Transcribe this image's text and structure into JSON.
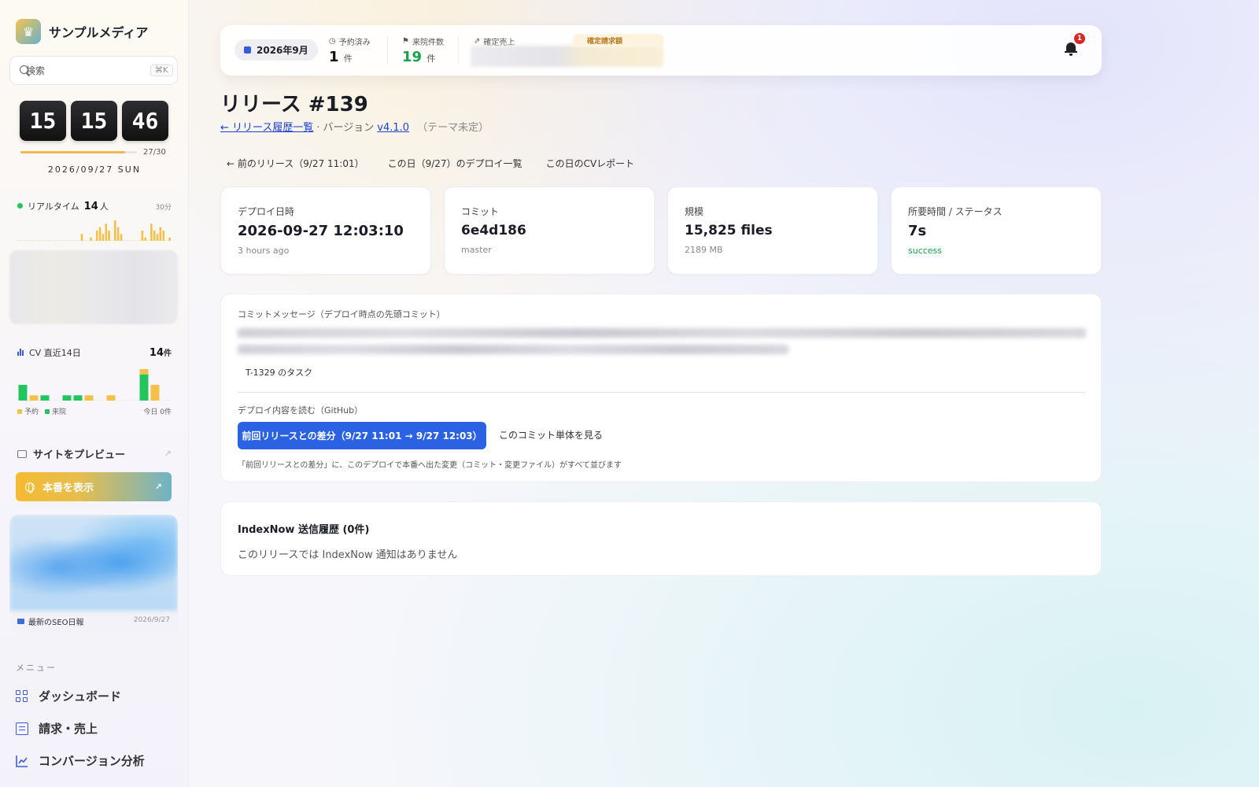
{
  "brand": {
    "name": "サンプルメディア"
  },
  "search": {
    "placeholder": "検索",
    "shortcut": "⌘K"
  },
  "clock": {
    "hh": "15",
    "mm": "15",
    "ss": "46"
  },
  "month_progress": {
    "label": "27/30",
    "fraction": 0.9
  },
  "date": "2026/09/27 SUN",
  "realtime": {
    "label": "リアルタイム",
    "count": "14",
    "unit": "人",
    "window": "30分",
    "bars": [
      0,
      0,
      0,
      0,
      0,
      0,
      0,
      0,
      0,
      0,
      0,
      0,
      0,
      0,
      0,
      0,
      0,
      0,
      0,
      0,
      0,
      2,
      0,
      0,
      1,
      0,
      3,
      4,
      2,
      5,
      3,
      0,
      6,
      4,
      2,
      0,
      0,
      0,
      0,
      0,
      0,
      3,
      1,
      0,
      5,
      3,
      2,
      4,
      3,
      0,
      1
    ]
  },
  "cv": {
    "label": "CV 直近14日",
    "total": "14",
    "unit": "件",
    "days": [
      {
        "reserve": 0,
        "visit": 3
      },
      {
        "reserve": 1,
        "visit": 0
      },
      {
        "reserve": 0,
        "visit": 1
      },
      {
        "reserve": 0,
        "visit": 0
      },
      {
        "reserve": 0,
        "visit": 1
      },
      {
        "reserve": 0,
        "visit": 1
      },
      {
        "reserve": 1,
        "visit": 0
      },
      {
        "reserve": 0,
        "visit": 0
      },
      {
        "reserve": 1,
        "visit": 0
      },
      {
        "reserve": 0,
        "visit": 0
      },
      {
        "reserve": 0,
        "visit": 0
      },
      {
        "reserve": 1,
        "visit": 5
      },
      {
        "reserve": 3,
        "visit": 0
      },
      {
        "reserve": 0,
        "visit": 0
      }
    ],
    "legend_reserve": "予約",
    "legend_visit": "来院",
    "today": "今日 0件",
    "color_reserve": "#f5c047",
    "color_visit": "#22c55e"
  },
  "preview": {
    "label": "サイトをプレビュー"
  },
  "production": {
    "label": "本番を表示"
  },
  "seo": {
    "label": "最新のSEO日報",
    "date": "2026/9/27"
  },
  "menu": {
    "title": "メニュー",
    "items": [
      {
        "label": "ダッシュボード",
        "icon": "grid-icon"
      },
      {
        "label": "請求・売上",
        "icon": "billing-icon"
      },
      {
        "label": "コンバージョン分析",
        "icon": "chart-line-icon"
      }
    ]
  },
  "topbar": {
    "month": "2026年9月",
    "reservations": {
      "label": "予約済み",
      "value": "1",
      "unit": "件"
    },
    "visits": {
      "label": "来院件数",
      "value": "19",
      "unit": "件"
    },
    "sales": {
      "label": "確定売上"
    },
    "billing": {
      "label": "確定請求額"
    },
    "notifications": "1"
  },
  "release": {
    "title": "リリース #139",
    "back_link": "← リリース履歴一覧",
    "sep": "·",
    "version_label": "バージョン",
    "version": "v4.1.0",
    "theme": "（テーマ未定）"
  },
  "subnav": {
    "prev": "← 前のリリース（9/27 11:01）",
    "deploys": "この日（9/27）のデプロイ一覧",
    "cv_report": "この日のCVレポート"
  },
  "cards": {
    "deploy": {
      "label": "デプロイ日時",
      "value": "2026-09-27 12:03:10",
      "sub": "3 hours ago"
    },
    "commit": {
      "label": "コミット",
      "value": "6e4d186",
      "sub": "master"
    },
    "scale": {
      "label": "規模",
      "value": "15,825 files",
      "sub": "2189 MB"
    },
    "status": {
      "label": "所要時間 / ステータス",
      "value": "7s",
      "sub": "success"
    }
  },
  "commit_message": {
    "label": "コミットメッセージ（デプロイ時点の先頭コミット）",
    "task": "T-1329 のタスク",
    "read_label": "デプロイ内容を読む（GitHub）",
    "diff_button": "前回リリースとの差分（9/27 11:01 → 9/27 12:03）",
    "single_commit": "このコミット単体を見る",
    "note": "「前回リリースとの差分」に、このデプロイで本番へ出た変更（コミット・変更ファイル）がすべて並びます"
  },
  "indexnow": {
    "title": "IndexNow 送信履歴 (0件)",
    "empty": "このリリースでは IndexNow 通知はありません"
  }
}
